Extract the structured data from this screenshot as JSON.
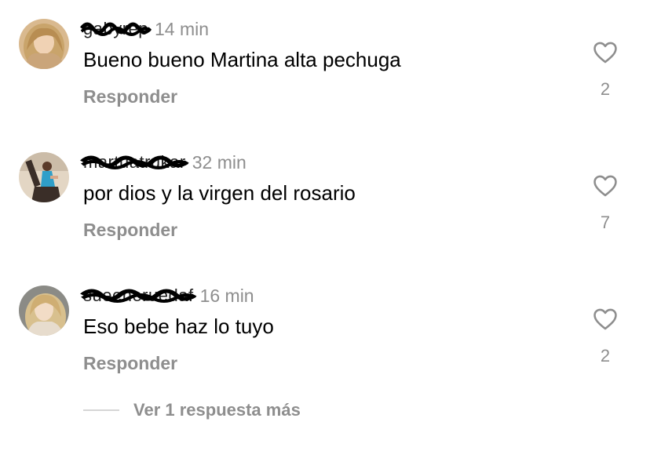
{
  "comments": [
    {
      "username": "gabyrep",
      "time": "14 min",
      "text": "Bueno bueno Martina alta pechuga",
      "reply_label": "Responder",
      "like_count": "2",
      "avatar_icon": "user-avatar",
      "like_icon": "heart-outline-icon"
    },
    {
      "username": "martuatrukar",
      "time": "32 min",
      "text": "por dios y la virgen del rosario",
      "reply_label": "Responder",
      "like_count": "7",
      "avatar_icon": "user-avatar",
      "like_icon": "heart-outline-icon"
    },
    {
      "username": "sueeneruedaf",
      "time": "16 min",
      "text": "Eso bebe haz lo tuyo",
      "reply_label": "Responder",
      "like_count": "2",
      "avatar_icon": "user-avatar",
      "like_icon": "heart-outline-icon"
    }
  ],
  "view_more": {
    "label": "Ver 1 respuesta más"
  },
  "colors": {
    "secondary_text": "#8e8e8e",
    "primary_text": "#000000",
    "divider": "#d6d6d6"
  }
}
